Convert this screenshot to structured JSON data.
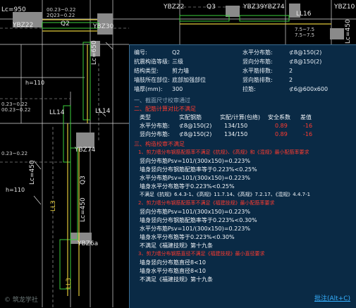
{
  "cad": {
    "labels": {
      "lc950": "Lc=950",
      "ybz22_a": "YBZ22",
      "q2_top": "Q2",
      "ybz30": "YBZ30",
      "ybz22_b": "YBZ22",
      "q3_top": "Q3",
      "ybz39_74": "YBZ39YBZ74",
      "ll16": "LL16",
      "ybz10": "YBZ10",
      "lc450_a": "Lc=450",
      "lc650": "Lc=650",
      "h110_a": "h=110",
      "h110_b": "h=110",
      "ll14_a": "LL14",
      "ll14_b": "LL14",
      "lc450_b": "Lc=450",
      "lc450_c": "Lc=450",
      "q3_mid": "Q3",
      "ybz74": "YBZ74",
      "ybz6a": "YBZ6a",
      "ll3_a": "LL3",
      "ll3_b": "LL3",
      "dim1": "00.23~0.22",
      "dim2": "2Q23~0.22",
      "dim3": "0.23~0.22",
      "dim4": "00.23~0.22",
      "dim5": "7.5~7.5",
      "dim6": "7.5~7.5",
      "dim7": "0.23~0.22"
    },
    "watermark": "© 筑龙学社"
  },
  "panel": {
    "props_left": [
      {
        "label": "编号:",
        "value": "Q2"
      },
      {
        "label": "抗震构造等级:",
        "value": "三级"
      },
      {
        "label": "结构类型:",
        "value": "剪力墙"
      },
      {
        "label": "墙肢所在部位:",
        "value": "底部加强部位"
      },
      {
        "label": "墙厚(mm):",
        "value": "300"
      }
    ],
    "props_right": [
      {
        "label": "水平分布筋:",
        "value": "⊄8@150(2)"
      },
      {
        "label": "竖向分布筋:",
        "value": "⊄8@150(2)"
      },
      {
        "label": "水平筋排数:",
        "value": "2"
      },
      {
        "label": "竖向筋排数:",
        "value": "2"
      },
      {
        "label": "拉筋:",
        "value": "⊄6@600x600"
      }
    ],
    "check1": "一、截面尺寸校审通过",
    "check2": "二、配筋计算对比不满足",
    "table": {
      "headers": [
        "类型",
        "实配钢筋",
        "实配/计算(包络)",
        "安全系数",
        "差值"
      ],
      "rows": [
        {
          "type": "水平分布筋:",
          "rebar": "⊄8@150(2)",
          "ratio": "134/150",
          "safety": "0.89",
          "diff": "-16"
        },
        {
          "type": "竖向分布筋:",
          "rebar": "⊄8@150(2)",
          "ratio": "134/150",
          "safety": "0.89",
          "diff": "-16"
        }
      ]
    },
    "check3": "三、构造校审不满足",
    "sub1": "1、剪力墙分布钢筋配筋率不满足《抗规》、《高规》和《混规》最小配筋率要求",
    "lines1": [
      "竖向分布筋Psv=101/(300x150)=0.223%",
      "墙身竖向分布钢筋配筋率等于0.223%<0.25%",
      "水平分布筋Psv=101/(300x150)=0.223%",
      "墙身水平分布筋等于0.223%<0.25%",
      "不满足《抗规》6.4.3-1、《高规》11.7.14、《高规》7.2.17、《混规》4.4.7-1"
    ],
    "sub2": "2、剪力墙分布钢筋配筋率不满足《福建技规》最小配筋率要求",
    "lines2": [
      "竖向分布筋Psv=101/(300x150)=0.223%",
      "墙身竖向分布钢筋配筋率等于0.223%<0.30%",
      "水平分布筋Psv=101/(300x150)=0.223%",
      "墙身水平分布筋等于0.223%<0.30%",
      "不满足《福建技规》第十九条"
    ],
    "sub3": "3、剪力墙分布钢筋直径不满足《福建技规》最小直径要求",
    "lines3": [
      "墙身竖向分布筋直径8<10",
      "墙身水平分布筋直径8<10",
      "不满足《福建技规》第十九条"
    ],
    "link": "批注(Alt+C)"
  },
  "colors": {
    "panel_bg": "#0a2a45",
    "error_red": "#ff3b30",
    "link_blue": "#35b0ff",
    "cad_green": "#3ccf3c",
    "cad_yellow": "#e0c83a"
  }
}
